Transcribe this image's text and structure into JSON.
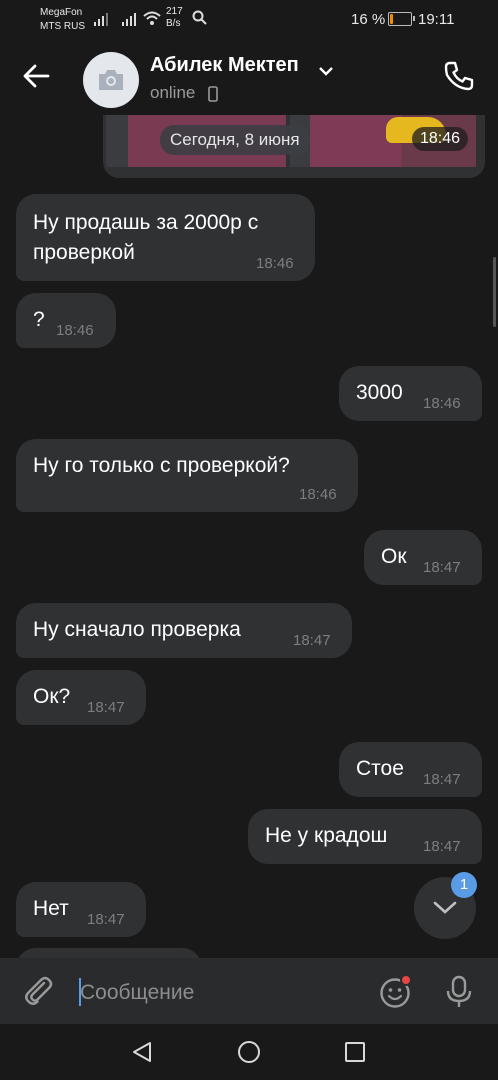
{
  "status_bar": {
    "carrier1": "MegaFon",
    "carrier2": "MTS RUS",
    "speed_value": "217",
    "speed_unit": "B/s",
    "battery_percent": "16 %",
    "time": "19:11",
    "battery_level": 0.16
  },
  "header": {
    "title": "Абилек Мектеп",
    "status": "online",
    "icons": [
      "back-arrow-icon",
      "camera-icon",
      "chevron-down-icon",
      "mobile-device-icon",
      "phone-call-icon"
    ]
  },
  "chat": {
    "media_message": {
      "date_label": "Сегодня, 8 июня",
      "time": "18:46"
    },
    "messages": [
      {
        "direction": "in",
        "line1": "Ну продашь за 2000р с",
        "line2": "проверкой",
        "time": "18:46"
      },
      {
        "direction": "in",
        "text": "?",
        "time": "18:46"
      },
      {
        "direction": "out",
        "text": "3000",
        "time": "18:46"
      },
      {
        "direction": "in",
        "text": "Ну го только с проверкой?",
        "time": "18:46"
      },
      {
        "direction": "out",
        "text": "Ок",
        "time": "18:47"
      },
      {
        "direction": "in",
        "text": "Ну сначало проверка",
        "time": "18:47"
      },
      {
        "direction": "in",
        "text": "Ок?",
        "time": "18:47"
      },
      {
        "direction": "out",
        "text": "Стое",
        "time": "18:47"
      },
      {
        "direction": "out",
        "text": "Не у крадош",
        "time": "18:47"
      },
      {
        "direction": "in",
        "text": "Нет",
        "time": "18:47"
      }
    ],
    "scroll_down_badge": "1"
  },
  "composer": {
    "placeholder": "Сообщение",
    "value": "",
    "icons": [
      "paperclip-icon",
      "sticker-icon",
      "microphone-icon"
    ]
  },
  "colors": {
    "background": "#19191a",
    "bubble": "#2f3133",
    "accent": "#5a9be6",
    "time_text": "#7e7e7e"
  }
}
